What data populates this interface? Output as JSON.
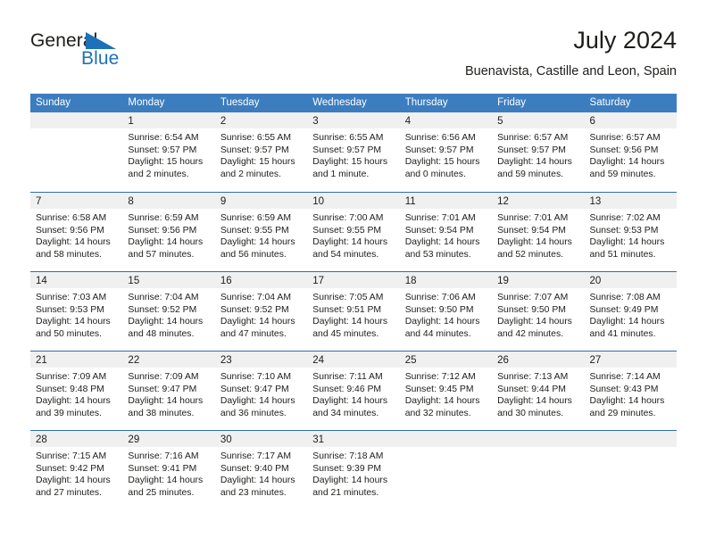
{
  "brand": {
    "name_part1": "General",
    "name_part2": "Blue",
    "logo_icon": "blue-triangle-flag-icon",
    "accent_color": "#1c71b8"
  },
  "header": {
    "title": "July 2024",
    "subtitle": "Buenavista, Castille and Leon, Spain"
  },
  "calendar": {
    "header_bg": "#3b7dbf",
    "row_separator_color": "#2f6daf",
    "daynum_band_bg": "#f0f0f0",
    "weekdays": [
      "Sunday",
      "Monday",
      "Tuesday",
      "Wednesday",
      "Thursday",
      "Friday",
      "Saturday"
    ],
    "weeks": [
      [
        {
          "day": "",
          "sunrise": "",
          "sunset": "",
          "daylight_line1": "",
          "daylight_line2": ""
        },
        {
          "day": "1",
          "sunrise": "Sunrise: 6:54 AM",
          "sunset": "Sunset: 9:57 PM",
          "daylight_line1": "Daylight: 15 hours",
          "daylight_line2": "and 2 minutes."
        },
        {
          "day": "2",
          "sunrise": "Sunrise: 6:55 AM",
          "sunset": "Sunset: 9:57 PM",
          "daylight_line1": "Daylight: 15 hours",
          "daylight_line2": "and 2 minutes."
        },
        {
          "day": "3",
          "sunrise": "Sunrise: 6:55 AM",
          "sunset": "Sunset: 9:57 PM",
          "daylight_line1": "Daylight: 15 hours",
          "daylight_line2": "and 1 minute."
        },
        {
          "day": "4",
          "sunrise": "Sunrise: 6:56 AM",
          "sunset": "Sunset: 9:57 PM",
          "daylight_line1": "Daylight: 15 hours",
          "daylight_line2": "and 0 minutes."
        },
        {
          "day": "5",
          "sunrise": "Sunrise: 6:57 AM",
          "sunset": "Sunset: 9:57 PM",
          "daylight_line1": "Daylight: 14 hours",
          "daylight_line2": "and 59 minutes."
        },
        {
          "day": "6",
          "sunrise": "Sunrise: 6:57 AM",
          "sunset": "Sunset: 9:56 PM",
          "daylight_line1": "Daylight: 14 hours",
          "daylight_line2": "and 59 minutes."
        }
      ],
      [
        {
          "day": "7",
          "sunrise": "Sunrise: 6:58 AM",
          "sunset": "Sunset: 9:56 PM",
          "daylight_line1": "Daylight: 14 hours",
          "daylight_line2": "and 58 minutes."
        },
        {
          "day": "8",
          "sunrise": "Sunrise: 6:59 AM",
          "sunset": "Sunset: 9:56 PM",
          "daylight_line1": "Daylight: 14 hours",
          "daylight_line2": "and 57 minutes."
        },
        {
          "day": "9",
          "sunrise": "Sunrise: 6:59 AM",
          "sunset": "Sunset: 9:55 PM",
          "daylight_line1": "Daylight: 14 hours",
          "daylight_line2": "and 56 minutes."
        },
        {
          "day": "10",
          "sunrise": "Sunrise: 7:00 AM",
          "sunset": "Sunset: 9:55 PM",
          "daylight_line1": "Daylight: 14 hours",
          "daylight_line2": "and 54 minutes."
        },
        {
          "day": "11",
          "sunrise": "Sunrise: 7:01 AM",
          "sunset": "Sunset: 9:54 PM",
          "daylight_line1": "Daylight: 14 hours",
          "daylight_line2": "and 53 minutes."
        },
        {
          "day": "12",
          "sunrise": "Sunrise: 7:01 AM",
          "sunset": "Sunset: 9:54 PM",
          "daylight_line1": "Daylight: 14 hours",
          "daylight_line2": "and 52 minutes."
        },
        {
          "day": "13",
          "sunrise": "Sunrise: 7:02 AM",
          "sunset": "Sunset: 9:53 PM",
          "daylight_line1": "Daylight: 14 hours",
          "daylight_line2": "and 51 minutes."
        }
      ],
      [
        {
          "day": "14",
          "sunrise": "Sunrise: 7:03 AM",
          "sunset": "Sunset: 9:53 PM",
          "daylight_line1": "Daylight: 14 hours",
          "daylight_line2": "and 50 minutes."
        },
        {
          "day": "15",
          "sunrise": "Sunrise: 7:04 AM",
          "sunset": "Sunset: 9:52 PM",
          "daylight_line1": "Daylight: 14 hours",
          "daylight_line2": "and 48 minutes."
        },
        {
          "day": "16",
          "sunrise": "Sunrise: 7:04 AM",
          "sunset": "Sunset: 9:52 PM",
          "daylight_line1": "Daylight: 14 hours",
          "daylight_line2": "and 47 minutes."
        },
        {
          "day": "17",
          "sunrise": "Sunrise: 7:05 AM",
          "sunset": "Sunset: 9:51 PM",
          "daylight_line1": "Daylight: 14 hours",
          "daylight_line2": "and 45 minutes."
        },
        {
          "day": "18",
          "sunrise": "Sunrise: 7:06 AM",
          "sunset": "Sunset: 9:50 PM",
          "daylight_line1": "Daylight: 14 hours",
          "daylight_line2": "and 44 minutes."
        },
        {
          "day": "19",
          "sunrise": "Sunrise: 7:07 AM",
          "sunset": "Sunset: 9:50 PM",
          "daylight_line1": "Daylight: 14 hours",
          "daylight_line2": "and 42 minutes."
        },
        {
          "day": "20",
          "sunrise": "Sunrise: 7:08 AM",
          "sunset": "Sunset: 9:49 PM",
          "daylight_line1": "Daylight: 14 hours",
          "daylight_line2": "and 41 minutes."
        }
      ],
      [
        {
          "day": "21",
          "sunrise": "Sunrise: 7:09 AM",
          "sunset": "Sunset: 9:48 PM",
          "daylight_line1": "Daylight: 14 hours",
          "daylight_line2": "and 39 minutes."
        },
        {
          "day": "22",
          "sunrise": "Sunrise: 7:09 AM",
          "sunset": "Sunset: 9:47 PM",
          "daylight_line1": "Daylight: 14 hours",
          "daylight_line2": "and 38 minutes."
        },
        {
          "day": "23",
          "sunrise": "Sunrise: 7:10 AM",
          "sunset": "Sunset: 9:47 PM",
          "daylight_line1": "Daylight: 14 hours",
          "daylight_line2": "and 36 minutes."
        },
        {
          "day": "24",
          "sunrise": "Sunrise: 7:11 AM",
          "sunset": "Sunset: 9:46 PM",
          "daylight_line1": "Daylight: 14 hours",
          "daylight_line2": "and 34 minutes."
        },
        {
          "day": "25",
          "sunrise": "Sunrise: 7:12 AM",
          "sunset": "Sunset: 9:45 PM",
          "daylight_line1": "Daylight: 14 hours",
          "daylight_line2": "and 32 minutes."
        },
        {
          "day": "26",
          "sunrise": "Sunrise: 7:13 AM",
          "sunset": "Sunset: 9:44 PM",
          "daylight_line1": "Daylight: 14 hours",
          "daylight_line2": "and 30 minutes."
        },
        {
          "day": "27",
          "sunrise": "Sunrise: 7:14 AM",
          "sunset": "Sunset: 9:43 PM",
          "daylight_line1": "Daylight: 14 hours",
          "daylight_line2": "and 29 minutes."
        }
      ],
      [
        {
          "day": "28",
          "sunrise": "Sunrise: 7:15 AM",
          "sunset": "Sunset: 9:42 PM",
          "daylight_line1": "Daylight: 14 hours",
          "daylight_line2": "and 27 minutes."
        },
        {
          "day": "29",
          "sunrise": "Sunrise: 7:16 AM",
          "sunset": "Sunset: 9:41 PM",
          "daylight_line1": "Daylight: 14 hours",
          "daylight_line2": "and 25 minutes."
        },
        {
          "day": "30",
          "sunrise": "Sunrise: 7:17 AM",
          "sunset": "Sunset: 9:40 PM",
          "daylight_line1": "Daylight: 14 hours",
          "daylight_line2": "and 23 minutes."
        },
        {
          "day": "31",
          "sunrise": "Sunrise: 7:18 AM",
          "sunset": "Sunset: 9:39 PM",
          "daylight_line1": "Daylight: 14 hours",
          "daylight_line2": "and 21 minutes."
        },
        {
          "day": "",
          "sunrise": "",
          "sunset": "",
          "daylight_line1": "",
          "daylight_line2": ""
        },
        {
          "day": "",
          "sunrise": "",
          "sunset": "",
          "daylight_line1": "",
          "daylight_line2": ""
        },
        {
          "day": "",
          "sunrise": "",
          "sunset": "",
          "daylight_line1": "",
          "daylight_line2": ""
        }
      ]
    ]
  }
}
